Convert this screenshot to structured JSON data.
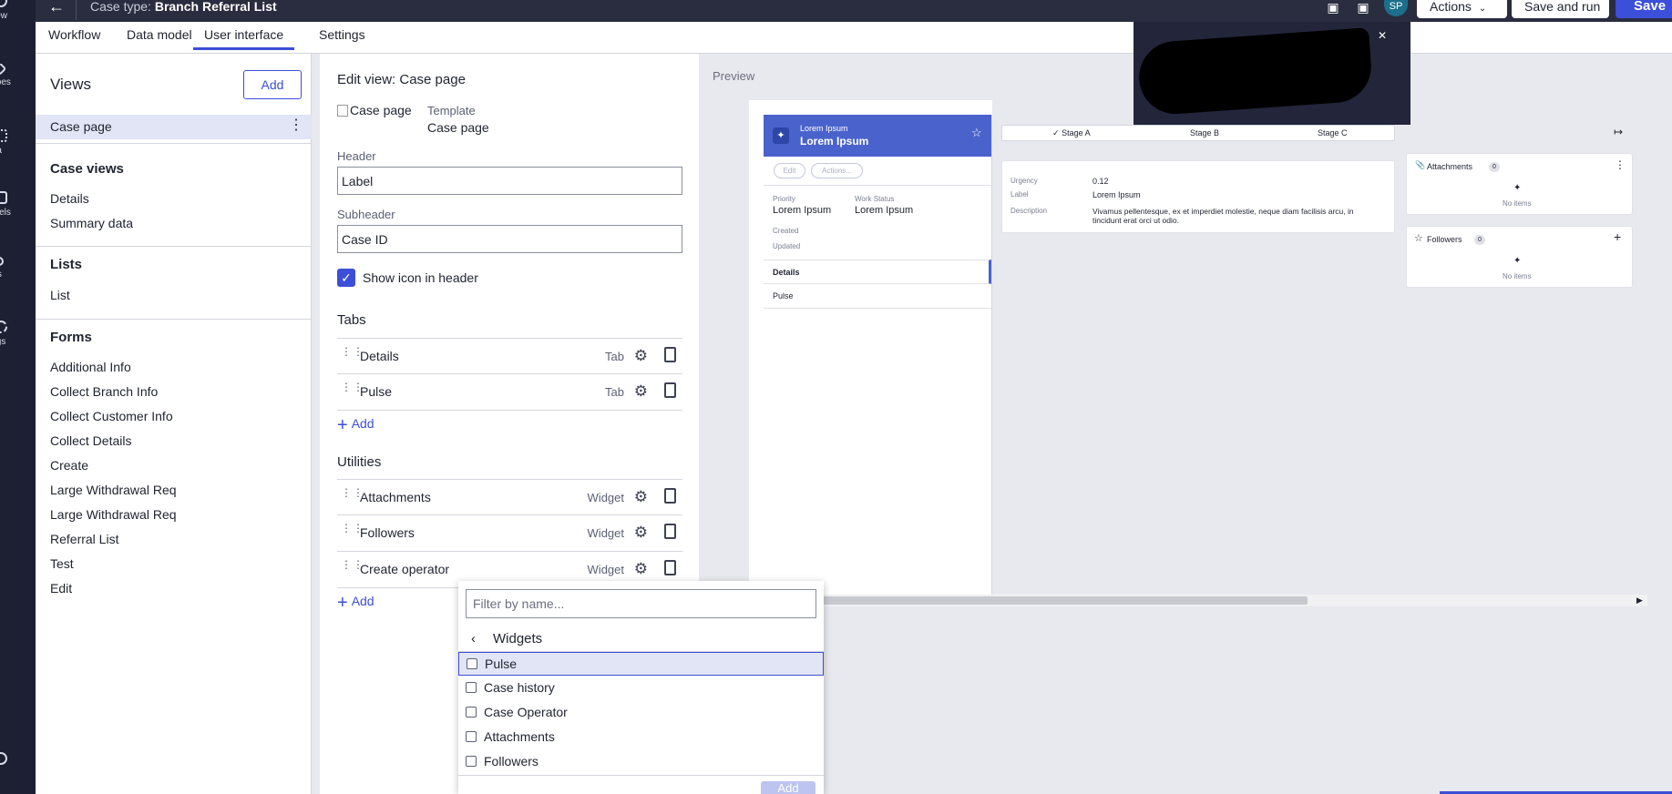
{
  "rail": {
    "items": [
      {
        "label": "view",
        "icon": "overview-icon"
      },
      {
        "label": "types",
        "icon": "case-types-icon"
      },
      {
        "label": "ata",
        "icon": "data-icon"
      },
      {
        "label": "anels",
        "icon": "channels-icon"
      },
      {
        "label": "ers",
        "icon": "users-icon"
      },
      {
        "label": "ings",
        "icon": "settings-icon"
      }
    ]
  },
  "topbar": {
    "case_type_prefix": "Case type:",
    "case_type_name": "Branch Referral List",
    "avatar": "SP",
    "actions": "Actions",
    "save_and_run": "Save and run",
    "save": "Save"
  },
  "tabs": [
    "Workflow",
    "Data model",
    "User interface",
    "Settings"
  ],
  "views": {
    "title": "Views",
    "add": "Add",
    "case_page": "Case page",
    "case_views_header": "Case views",
    "case_views": [
      "Details",
      "Summary data"
    ],
    "lists_header": "Lists",
    "lists": [
      "List"
    ],
    "forms_header": "Forms",
    "forms": [
      "Additional Info",
      "Collect Branch Info",
      "Collect Customer Info",
      "Collect Details",
      "Create",
      "Large Withdrawal Req",
      "Large Withdrawal Req",
      "Referral List",
      "Test",
      "Edit"
    ]
  },
  "edit": {
    "title": "Edit view: Case page",
    "img_alt": "Case page",
    "template_label": "Template",
    "template_value": "Case page",
    "header_label": "Header",
    "header_value": "Label",
    "subheader_label": "Subheader",
    "subheader_value": "Case ID",
    "show_icon": "Show icon in header",
    "tabs_header": "Tabs",
    "tabs": [
      {
        "name": "Details",
        "type": "Tab"
      },
      {
        "name": "Pulse",
        "type": "Tab"
      }
    ],
    "add": "Add",
    "utilities_header": "Utilities",
    "utilities": [
      {
        "name": "Attachments",
        "type": "Widget"
      },
      {
        "name": "Followers",
        "type": "Widget"
      },
      {
        "name": "Create operator",
        "type": "Widget"
      }
    ]
  },
  "preview": {
    "label": "Preview",
    "header_small": "Lorem Ipsum",
    "header_big": "Lorem Ipsum",
    "edit": "Edit",
    "actions": "Actions...",
    "priority_label": "Priority",
    "priority_value": "Lorem Ipsum",
    "work_status_label": "Work Status",
    "work_status_value": "Lorem Ipsum",
    "created": "Created",
    "updated": "Updated",
    "nav_details": "Details",
    "nav_pulse": "Pulse",
    "stages": [
      "Stage A",
      "Stage B",
      "Stage C"
    ],
    "urgency_label": "Urgency",
    "urgency_value": "0.12",
    "label_label": "Label",
    "label_value": "Lorem Ipsum",
    "description_label": "Description",
    "description_value": "Vivamus pellentesque, ex et imperdiet molestie, neque diam facilisis arcu, in tincidunt erat orci ut odio.",
    "attachments": "Attachments",
    "attachments_count": "0",
    "followers": "Followers",
    "followers_count": "0",
    "no_items": "No items"
  },
  "dropdown": {
    "filter_placeholder": "Filter by name...",
    "header": "Widgets",
    "items": [
      "Pulse",
      "Case history",
      "Case Operator",
      "Attachments",
      "Followers"
    ],
    "add": "Add"
  }
}
